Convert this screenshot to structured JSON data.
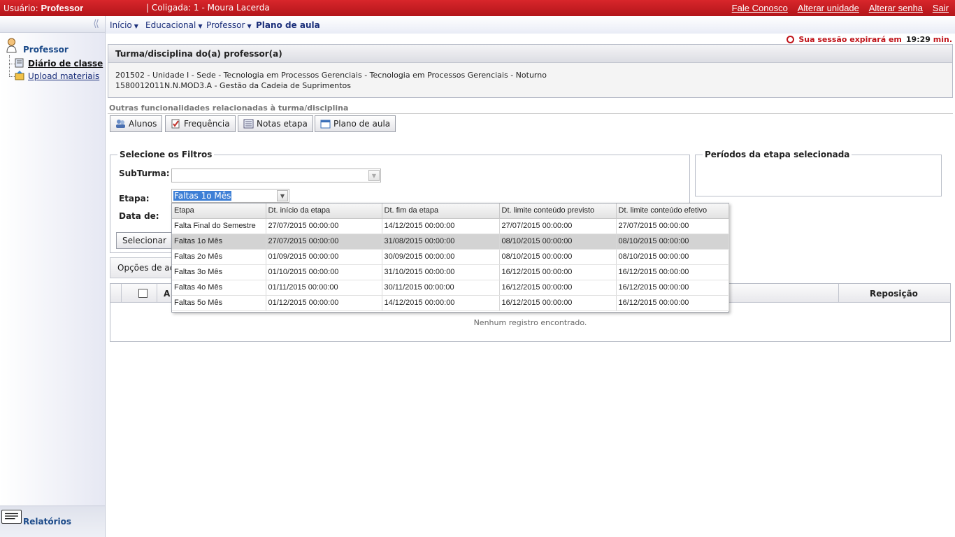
{
  "topbar": {
    "user_label": "Usuário:",
    "user_name": "Professor",
    "coligada": "|  Coligada: 1 - Moura Lacerda",
    "links": [
      "Fale Conosco",
      "Alterar unidade",
      "Alterar senha",
      "Sair"
    ]
  },
  "nav": {
    "inicio": "Início",
    "educacional": "Educacional",
    "professor": "Professor",
    "current": "Plano de aula"
  },
  "sidebar": {
    "title": "Professor",
    "items": [
      "Diário de classe",
      "Upload materiais"
    ],
    "relatorios": "Relatórios"
  },
  "session": {
    "text": "Sua sessão expirará em",
    "time": "19:29",
    "unit": "min."
  },
  "panel": {
    "title": "Turma/disciplina do(a) professor(a)",
    "line1": "201502 - Unidade I - Sede - Tecnologia em Processos Gerenciais - Tecnologia em Processos Gerenciais - Noturno",
    "line2": "1580012011N.N.MOD3.A - Gestão da Cadeia de Suprimentos"
  },
  "outras": {
    "title": "Outras funcionalidades relacionadas à turma/disciplina",
    "buttons": [
      "Alunos",
      "Frequência",
      "Notas etapa",
      "Plano de aula"
    ]
  },
  "filtros": {
    "legend": "Selecione os Filtros",
    "subturma_label": "SubTurma:",
    "etapa_label": "Etapa:",
    "etapa_value": "Faltas 1o Mês",
    "data_label": "Data de:",
    "selecionar": "Selecionar"
  },
  "periodos": {
    "legend": "Períodos da etapa selecionada"
  },
  "opcoes": {
    "label": "Opções de ações"
  },
  "grid": {
    "col_a": "A",
    "reposicao": "Reposição",
    "empty": "Nenhum registro encontrado."
  },
  "dropdown": {
    "headers": [
      "Etapa",
      "Dt. início da etapa",
      "Dt. fim da etapa",
      "Dt. limite conteúdo previsto",
      "Dt. limite conteúdo efetivo"
    ],
    "rows": [
      [
        "Falta Final do Semestre",
        "27/07/2015 00:00:00",
        "14/12/2015 00:00:00",
        "27/07/2015 00:00:00",
        "27/07/2015 00:00:00"
      ],
      [
        "Faltas 1o Mês",
        "27/07/2015 00:00:00",
        "31/08/2015 00:00:00",
        "08/10/2015 00:00:00",
        "08/10/2015 00:00:00"
      ],
      [
        "Faltas 2o Mês",
        "01/09/2015 00:00:00",
        "30/09/2015 00:00:00",
        "08/10/2015 00:00:00",
        "08/10/2015 00:00:00"
      ],
      [
        "Faltas 3o Mês",
        "01/10/2015 00:00:00",
        "31/10/2015 00:00:00",
        "16/12/2015 00:00:00",
        "16/12/2015 00:00:00"
      ],
      [
        "Faltas 4o Mês",
        "01/11/2015 00:00:00",
        "30/11/2015 00:00:00",
        "16/12/2015 00:00:00",
        "16/12/2015 00:00:00"
      ],
      [
        "Faltas 5o Mês",
        "01/12/2015 00:00:00",
        "14/12/2015 00:00:00",
        "16/12/2015 00:00:00",
        "16/12/2015 00:00:00"
      ]
    ],
    "selected_row": 1
  },
  "colors": {
    "topbar": "#c41d22",
    "nav_text": "#1b2f7a",
    "session": "#c0151b",
    "selection": "#3d7fd6"
  }
}
